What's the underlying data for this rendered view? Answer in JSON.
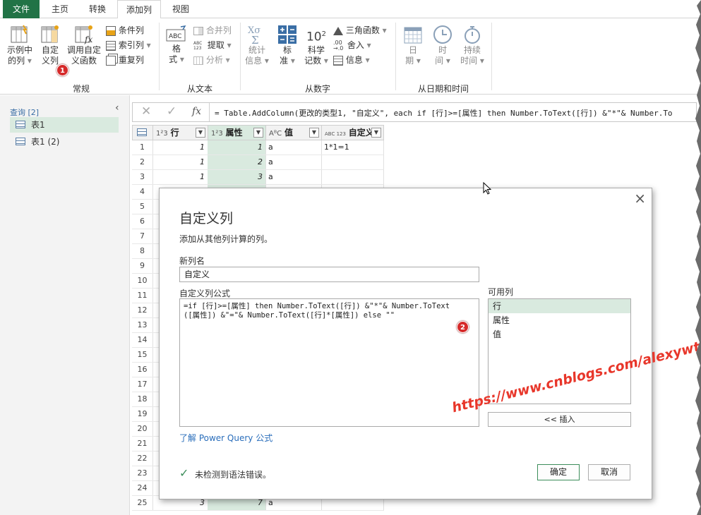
{
  "tabs": [
    {
      "label": "文件"
    },
    {
      "label": "主页"
    },
    {
      "label": "转换"
    },
    {
      "label": "添加列"
    },
    {
      "label": "视图"
    }
  ],
  "ribbon": {
    "general": {
      "group_label": "常规",
      "example_col": [
        "示例中",
        "的列"
      ],
      "custom_col": [
        "自定",
        "义列"
      ],
      "invoke_fn": [
        "调用自定",
        "义函数"
      ],
      "cond_col": "条件列",
      "index_col": "索引列",
      "dup_col": "重复列"
    },
    "text": {
      "group_label": "从文本",
      "format": [
        "格",
        "式"
      ],
      "merge": "合并列",
      "extract": "提取",
      "parse": "分析",
      "abc_top": "ABC",
      "abc123": [
        "ABC",
        "123"
      ]
    },
    "number": {
      "group_label": "从数字",
      "stats": [
        "统计",
        "信息"
      ],
      "standard": [
        "标",
        "准"
      ],
      "scientific": [
        "科学",
        "记数"
      ],
      "trig": "三角函数",
      "round": "舍入",
      "info": "信息",
      "ten_sq": "10",
      "sq": "2",
      "dot00": ".00",
      "arrow": "→.0"
    },
    "datetime": {
      "group_label": "从日期和时间",
      "date": [
        "日",
        "期"
      ],
      "time": [
        "时",
        "间"
      ],
      "duration": [
        "持续",
        "时间"
      ]
    }
  },
  "query_pane": {
    "header": "查询 [2]",
    "items": [
      "表1",
      "表1 (2)"
    ]
  },
  "formula_bar": {
    "fx": "fx",
    "formula": "= Table.AddColumn(更改的类型1, \"自定义\", each if [行]>=[属性] then Number.ToText([行]) &\"*\"& Number.To"
  },
  "grid": {
    "columns": [
      {
        "type": "1²3",
        "name": "行"
      },
      {
        "type": "1²3",
        "name": "属性"
      },
      {
        "type": "AᴮC",
        "name": "值"
      },
      {
        "type": "ABC 123",
        "name": "自定义"
      }
    ],
    "row_numbers": [
      "1",
      "2",
      "3",
      "4",
      "5",
      "6",
      "7",
      "8",
      "9",
      "10",
      "11",
      "12",
      "13",
      "14",
      "15",
      "16",
      "17",
      "18",
      "19",
      "20",
      "21",
      "22",
      "23",
      "24",
      "25"
    ],
    "rows": [
      {
        "r": "1",
        "a": "1",
        "v": "a",
        "c": "1*1=1"
      },
      {
        "r": "1",
        "a": "2",
        "v": "a",
        "c": ""
      },
      {
        "r": "1",
        "a": "3",
        "v": "a",
        "c": ""
      }
    ],
    "last_row": {
      "r": "3",
      "a": "7",
      "v": "a"
    }
  },
  "dialog": {
    "title": "自定义列",
    "subtitle": "添加从其他列计算的列。",
    "name_label": "新列名",
    "name_value": "自定义",
    "formula_label": "自定义列公式",
    "formula_line1": "=if [行]>=[属性] then Number.ToText([行]) &\"*\"& Number.ToText",
    "formula_line2": "([属性]) &\"=\"& Number.ToText([行]*[属性]) else \"\"",
    "available_label": "可用列",
    "available": [
      "行",
      "属性",
      "值"
    ],
    "insert_button": "<< 插入",
    "learn_link": "了解 Power Query 公式",
    "status": "未检测到语法错误。",
    "ok": "确定",
    "cancel": "取消",
    "close": "×"
  },
  "badges": {
    "one": "1",
    "two": "2"
  },
  "watermark": "https://www.cnblogs.com/alexywt/",
  "colors": {
    "accent": "#217346",
    "selected": "#d9eadf",
    "badge": "#d62a2a",
    "watermark": "#e8362a"
  }
}
